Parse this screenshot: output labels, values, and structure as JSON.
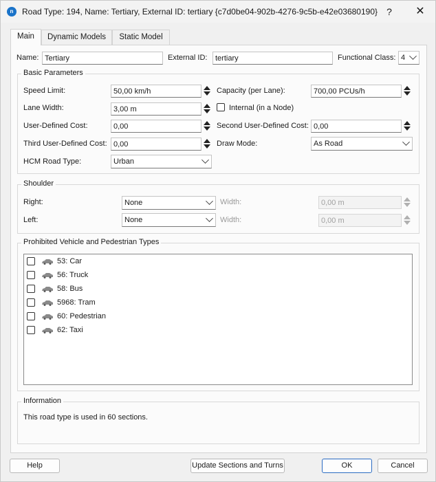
{
  "window": {
    "title": "Road Type: 194, Name: Tertiary, External ID: tertiary  {c7d0be04-902b-4276-9c5b-e42e03680190}",
    "help_glyph": "?",
    "close_glyph": "✕",
    "app_icon_text": "n"
  },
  "tabs": [
    {
      "label": "Main",
      "active": true
    },
    {
      "label": "Dynamic Models",
      "active": false
    },
    {
      "label": "Static Model",
      "active": false
    }
  ],
  "header": {
    "name_label": "Name:",
    "name_value": "Tertiary",
    "external_id_label": "External ID:",
    "external_id_value": "tertiary",
    "functional_class_label": "Functional Class:",
    "functional_class_value": "4"
  },
  "basic": {
    "title": "Basic Parameters",
    "speed_limit_label": "Speed Limit:",
    "speed_limit_value": "50,00 km/h",
    "capacity_label": "Capacity (per Lane):",
    "capacity_value": "700,00 PCUs/h",
    "lane_width_label": "Lane Width:",
    "lane_width_value": "3,00 m",
    "internal_label": "Internal (in a Node)",
    "user_cost_label": "User-Defined Cost:",
    "user_cost_value": "0,00",
    "second_cost_label": "Second User-Defined Cost:",
    "second_cost_value": "0,00",
    "third_cost_label": "Third User-Defined Cost:",
    "third_cost_value": "0,00",
    "draw_mode_label": "Draw Mode:",
    "draw_mode_value": "As Road",
    "hcm_label": "HCM Road Type:",
    "hcm_value": "Urban"
  },
  "shoulder": {
    "title": "Shoulder",
    "right_label": "Right:",
    "right_value": "None",
    "left_label": "Left:",
    "left_value": "None",
    "width_label": "Width:",
    "right_width_value": "0,00 m",
    "left_width_value": "0,00 m"
  },
  "prohibited": {
    "title": "Prohibited Vehicle and Pedestrian Types",
    "items": [
      {
        "label": "53: Car"
      },
      {
        "label": "56: Truck"
      },
      {
        "label": "58: Bus"
      },
      {
        "label": "5968: Tram"
      },
      {
        "label": "60: Pedestrian"
      },
      {
        "label": "62: Taxi"
      }
    ]
  },
  "information": {
    "title": "Information",
    "text": "This road type is used in 60 sections."
  },
  "buttons": {
    "help": "Help",
    "update": "Update Sections and Turns",
    "ok": "OK",
    "cancel": "Cancel"
  },
  "colors": {
    "accent": "#1a73c9",
    "primary_border": "#2a6bc2"
  }
}
